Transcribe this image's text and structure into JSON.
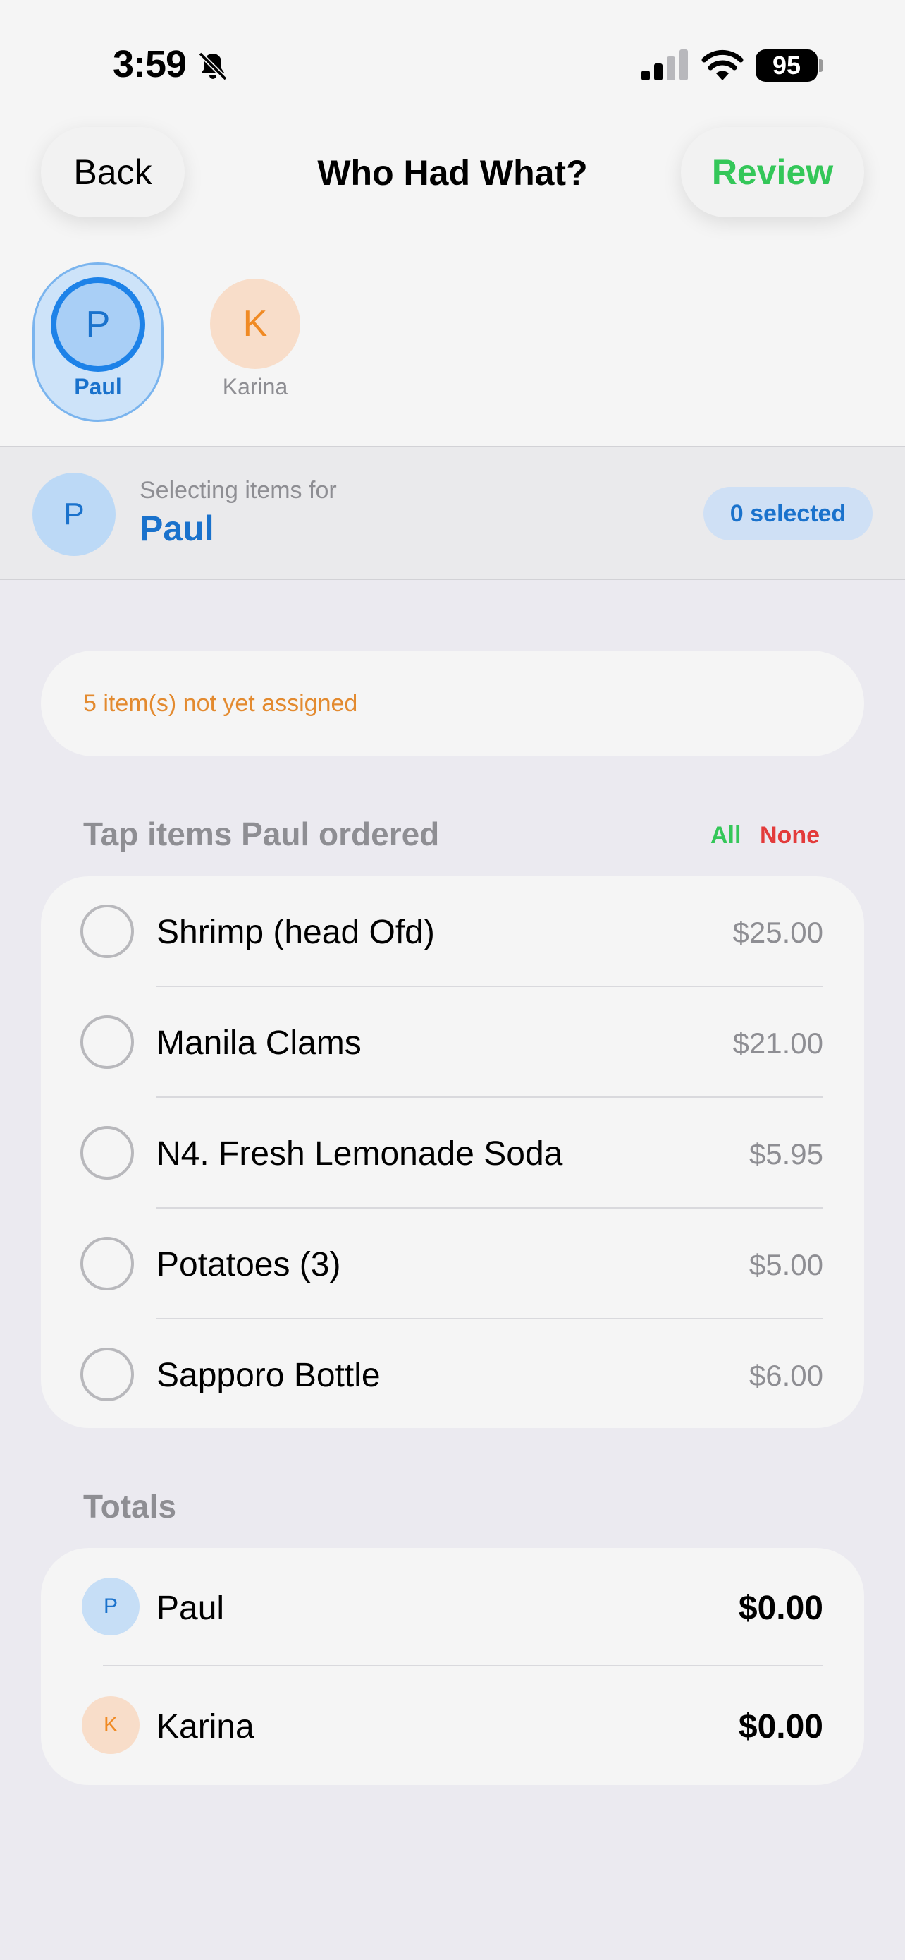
{
  "status_bar": {
    "time": "3:59",
    "battery": "95",
    "icons": [
      "bell-slash-icon",
      "signal-icon",
      "wifi-icon",
      "battery-icon"
    ]
  },
  "nav": {
    "back_label": "Back",
    "title": "Who Had What?",
    "review_label": "Review"
  },
  "people": [
    {
      "initial": "P",
      "name": "Paul",
      "selected": true,
      "color": "#1d82e8",
      "bg": "#a9cff6"
    },
    {
      "initial": "K",
      "name": "Karina",
      "selected": false,
      "color": "#f08a24",
      "bg": "#f8ddc9"
    }
  ],
  "selecting": {
    "caption": "Selecting items for",
    "initial": "P",
    "name": "Paul",
    "badge": "0 selected"
  },
  "notice": {
    "text": "5 item(s) not yet assigned",
    "color": "#e38a2f"
  },
  "items_section": {
    "title": "Tap items Paul ordered",
    "all_label": "All",
    "none_label": "None",
    "items": [
      {
        "name": "Shrimp (head Ofd)",
        "price": "$25.00",
        "checked": false
      },
      {
        "name": "Manila Clams",
        "price": "$21.00",
        "checked": false
      },
      {
        "name": "N4. Fresh Lemonade Soda",
        "price": "$5.95",
        "checked": false
      },
      {
        "name": "Potatoes (3)",
        "price": "$5.00",
        "checked": false
      },
      {
        "name": "Sapporo Bottle",
        "price": "$6.00",
        "checked": false
      }
    ]
  },
  "totals": {
    "title": "Totals",
    "rows": [
      {
        "initial": "P",
        "name": "Paul",
        "amount": "$0.00"
      },
      {
        "initial": "K",
        "name": "Karina",
        "amount": "$0.00"
      }
    ]
  },
  "colors": {
    "accent_blue": "#1d82e8",
    "accent_green": "#34c759",
    "accent_red": "#e33b3b",
    "accent_orange": "#f08a24"
  }
}
